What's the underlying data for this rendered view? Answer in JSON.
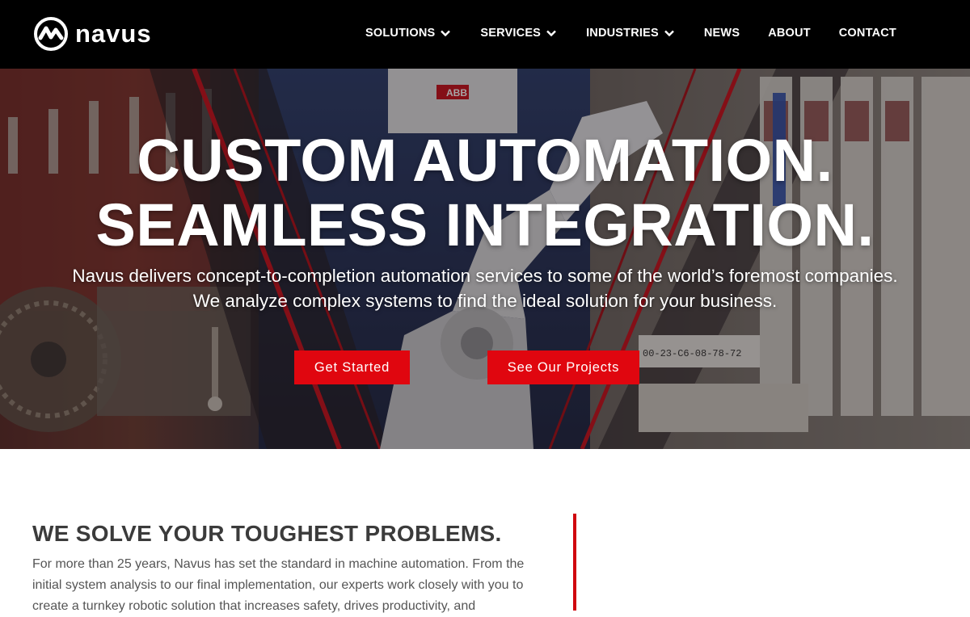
{
  "brand": {
    "name": "Navus",
    "logo_text": "navus",
    "accent_color": "#e0060f",
    "header_color": "#000000"
  },
  "nav": {
    "items": [
      {
        "label": "SOLUTIONS",
        "has_dropdown": true
      },
      {
        "label": "SERVICES",
        "has_dropdown": true
      },
      {
        "label": "INDUSTRIES",
        "has_dropdown": true
      },
      {
        "label": "NEWS",
        "has_dropdown": false
      },
      {
        "label": "ABOUT",
        "has_dropdown": false
      },
      {
        "label": "CONTACT",
        "has_dropdown": false
      }
    ]
  },
  "hero": {
    "title_line1": "CUSTOM AUTOMATION.",
    "title_line2": "SEAMLESS INTEGRATION.",
    "subtitle_line1": "Navus delivers concept-to-completion automation services to some of the world’s foremost companies.",
    "subtitle_line2": "We analyze complex systems to find the ideal solution for your business.",
    "primary_button": "Get Started",
    "secondary_button": "See Our Projects",
    "background_image": "industrial-robot-arm-photo",
    "machine_label": "00-23-C6-08-78-72",
    "robot_brand_mark": "ABB"
  },
  "intro": {
    "heading": "WE SOLVE YOUR TOUGHEST PROBLEMS.",
    "body": "For more than 25 years, Navus has set the standard in machine automation. From the initial system analysis to our final implementation, our experts work closely with you to create a turnkey robotic solution that increases safety, drives productivity, and"
  }
}
